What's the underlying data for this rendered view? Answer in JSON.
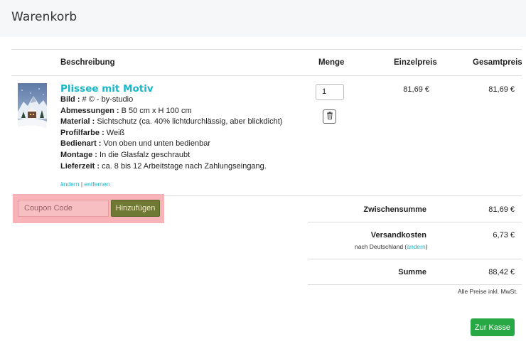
{
  "page": {
    "title": "Warenkorb"
  },
  "table": {
    "headers": {
      "description": "Beschreibung",
      "quantity": "Menge",
      "unit_price": "Einzelpreis",
      "total_price": "Gesamtpreis"
    }
  },
  "item": {
    "title": "Plissee mit Motiv",
    "attributes": [
      {
        "label": "Bild :",
        "value": " # © - by-studio"
      },
      {
        "label": "Abmessungen :",
        "value": " B 50 cm x H 100 cm"
      },
      {
        "label": "Material :",
        "value": " Sichtschutz (ca. 40% lichtdurchlässig, aber blickdicht)"
      },
      {
        "label": "Profilfarbe :",
        "value": " Weiß"
      },
      {
        "label": "Bedienart :",
        "value": " Von oben und unten bedienbar"
      },
      {
        "label": "Montage :",
        "value": " In die Glasfalz geschraubt"
      },
      {
        "label": "Lieferzeit :",
        "value": " ca. 8 bis 12 Arbeitstage nach Zahlungseingang."
      }
    ],
    "edit_link": "ändern",
    "separator": "|",
    "remove_link": "entfernen",
    "quantity": "1",
    "unit_price": "81,69 €",
    "total_price": "81,69 €",
    "trash_icon": "trash-icon"
  },
  "coupon": {
    "placeholder": "Coupon Code",
    "button_label": "Hinzufügen"
  },
  "summary": {
    "subtotal_label": "Zwischensumme",
    "subtotal_value": "81,69 €",
    "shipping_label": "Versandkosten",
    "shipping_value": "6,73 €",
    "shipping_note_prefix": "nach Deutschland (",
    "shipping_note_link": "ändern",
    "shipping_note_suffix": ")",
    "total_label": "Summe",
    "total_value": "88,42 €",
    "tax_note": "Alle Preise inkl. MwSt."
  },
  "checkout": {
    "label": "Zur Kasse"
  },
  "colors": {
    "accent": "#19b5c9",
    "checkout": "#28a745",
    "coupon_button": "#6e7a33",
    "coupon_highlight": "#f7b3b8"
  }
}
